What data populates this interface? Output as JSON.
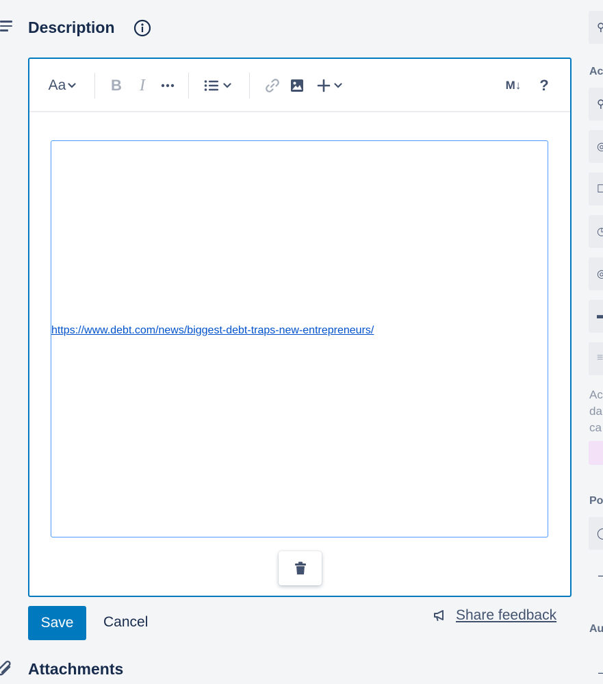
{
  "description": {
    "title": "Description"
  },
  "toolbar": {
    "text_style_label": "Aa",
    "bold_label": "B",
    "italic_label": "I",
    "markdown_label": "M↓",
    "help_label": "?"
  },
  "editor": {
    "link_text": "https://www.debt.com/news/biggest-debt-traps-new-entrepreneurs/"
  },
  "actions": {
    "save_label": "Save",
    "cancel_label": "Cancel",
    "feedback_label": "Share feedback"
  },
  "attachments": {
    "title": "Attachments"
  },
  "sidebar": {
    "heading_add": "Ac",
    "text_line1": "Ac",
    "text_line2": "da",
    "text_line3": "ca",
    "heading_power": "Po",
    "heading_auto": "Au"
  },
  "colors": {
    "accent": "#0079bf",
    "link": "#0052cc",
    "text": "#172b4d",
    "icon": "#42526e"
  }
}
